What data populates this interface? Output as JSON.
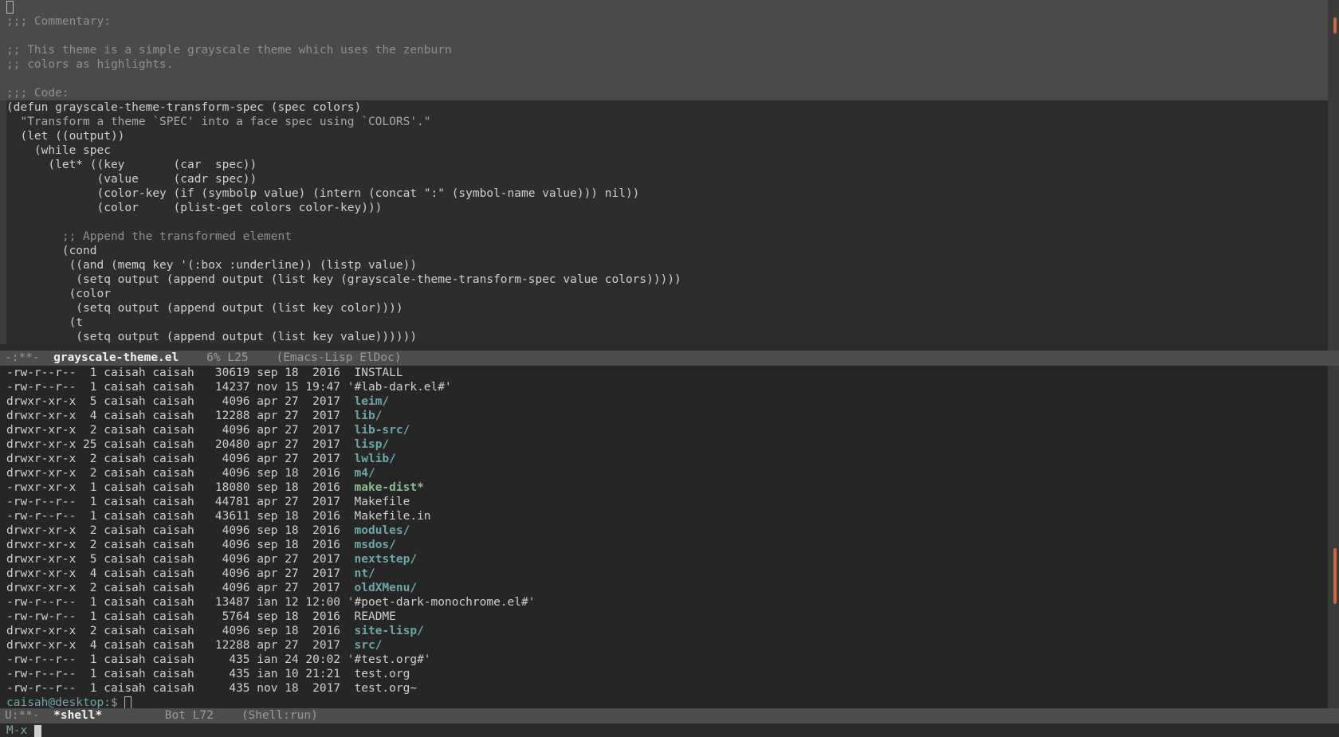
{
  "editor": {
    "commentary": [
      ";;; Commentary:",
      "",
      ";; This theme is a simple grayscale theme which uses the zenburn",
      ";; colors as highlights.",
      "",
      ";;; Code:"
    ],
    "code": [
      "(defun grayscale-theme-transform-spec (spec colors)",
      "  \"Transform a theme `SPEC' into a face spec using `COLORS'.\"",
      "  (let ((output))",
      "    (while spec",
      "      (let* ((key       (car  spec))",
      "             (value     (cadr spec))",
      "             (color-key (if (symbolp value) (intern (concat \":\" (symbol-name value))) nil))",
      "             (color     (plist-get colors color-key)))",
      "",
      "        ;; Append the transformed element",
      "        (cond",
      "         ((and (memq key '(:box :underline)) (listp value))",
      "          (setq output (append output (list key (grayscale-theme-transform-spec value colors)))))",
      "         (color",
      "          (setq output (append output (list key color))))",
      "         (t",
      "          (setq output (append output (list key value))))))"
    ]
  },
  "modeline_top": {
    "status": "-:**-  ",
    "buffer": "grayscale-theme.el",
    "position": "    6% L25    ",
    "mode": "(Emacs-Lisp ElDoc)"
  },
  "shell": {
    "rows": [
      {
        "perms": "-rw-r--r-- ",
        "links": " 1",
        "owner": "caisah",
        "group": "caisah",
        "size": "30619",
        "month": "sep",
        "day": "18",
        "time": " 2016",
        "name": "INSTALL",
        "kind": "file"
      },
      {
        "perms": "-rw-r--r-- ",
        "links": " 1",
        "owner": "caisah",
        "group": "caisah",
        "size": "14237",
        "month": "nov",
        "day": "15",
        "time": "19:47",
        "name": "'#lab-dark.el#'",
        "kind": "file",
        "quoted": true
      },
      {
        "perms": "drwxr-xr-x ",
        "links": " 5",
        "owner": "caisah",
        "group": "caisah",
        "size": " 4096",
        "month": "apr",
        "day": "27",
        "time": " 2017",
        "name": "leim",
        "kind": "dir"
      },
      {
        "perms": "drwxr-xr-x ",
        "links": " 4",
        "owner": "caisah",
        "group": "caisah",
        "size": "12288",
        "month": "apr",
        "day": "27",
        "time": " 2017",
        "name": "lib",
        "kind": "dir"
      },
      {
        "perms": "drwxr-xr-x ",
        "links": " 2",
        "owner": "caisah",
        "group": "caisah",
        "size": " 4096",
        "month": "apr",
        "day": "27",
        "time": " 2017",
        "name": "lib-src",
        "kind": "dir"
      },
      {
        "perms": "drwxr-xr-x ",
        "links": "25",
        "owner": "caisah",
        "group": "caisah",
        "size": "20480",
        "month": "apr",
        "day": "27",
        "time": " 2017",
        "name": "lisp",
        "kind": "dir"
      },
      {
        "perms": "drwxr-xr-x ",
        "links": " 2",
        "owner": "caisah",
        "group": "caisah",
        "size": " 4096",
        "month": "apr",
        "day": "27",
        "time": " 2017",
        "name": "lwlib",
        "kind": "dir"
      },
      {
        "perms": "drwxr-xr-x ",
        "links": " 2",
        "owner": "caisah",
        "group": "caisah",
        "size": " 4096",
        "month": "sep",
        "day": "18",
        "time": " 2016",
        "name": "m4",
        "kind": "dir"
      },
      {
        "perms": "-rwxr-xr-x ",
        "links": " 1",
        "owner": "caisah",
        "group": "caisah",
        "size": "18080",
        "month": "sep",
        "day": "18",
        "time": " 2016",
        "name": "make-dist",
        "kind": "exe"
      },
      {
        "perms": "-rw-r--r-- ",
        "links": " 1",
        "owner": "caisah",
        "group": "caisah",
        "size": "44781",
        "month": "apr",
        "day": "27",
        "time": " 2017",
        "name": "Makefile",
        "kind": "file"
      },
      {
        "perms": "-rw-r--r-- ",
        "links": " 1",
        "owner": "caisah",
        "group": "caisah",
        "size": "43611",
        "month": "sep",
        "day": "18",
        "time": " 2016",
        "name": "Makefile.in",
        "kind": "file"
      },
      {
        "perms": "drwxr-xr-x ",
        "links": " 2",
        "owner": "caisah",
        "group": "caisah",
        "size": " 4096",
        "month": "sep",
        "day": "18",
        "time": " 2016",
        "name": "modules",
        "kind": "dir"
      },
      {
        "perms": "drwxr-xr-x ",
        "links": " 2",
        "owner": "caisah",
        "group": "caisah",
        "size": " 4096",
        "month": "sep",
        "day": "18",
        "time": " 2016",
        "name": "msdos",
        "kind": "dir"
      },
      {
        "perms": "drwxr-xr-x ",
        "links": " 5",
        "owner": "caisah",
        "group": "caisah",
        "size": " 4096",
        "month": "apr",
        "day": "27",
        "time": " 2017",
        "name": "nextstep",
        "kind": "dir"
      },
      {
        "perms": "drwxr-xr-x ",
        "links": " 4",
        "owner": "caisah",
        "group": "caisah",
        "size": " 4096",
        "month": "apr",
        "day": "27",
        "time": " 2017",
        "name": "nt",
        "kind": "dir"
      },
      {
        "perms": "drwxr-xr-x ",
        "links": " 2",
        "owner": "caisah",
        "group": "caisah",
        "size": " 4096",
        "month": "apr",
        "day": "27",
        "time": " 2017",
        "name": "oldXMenu",
        "kind": "dir"
      },
      {
        "perms": "-rw-r--r-- ",
        "links": " 1",
        "owner": "caisah",
        "group": "caisah",
        "size": "13487",
        "month": "ian",
        "day": "12",
        "time": "12:00",
        "name": "'#poet-dark-monochrome.el#'",
        "kind": "file",
        "quoted": true
      },
      {
        "perms": "-rw-rw-r-- ",
        "links": " 1",
        "owner": "caisah",
        "group": "caisah",
        "size": " 5764",
        "month": "sep",
        "day": "18",
        "time": " 2016",
        "name": "README",
        "kind": "file"
      },
      {
        "perms": "drwxr-xr-x ",
        "links": " 2",
        "owner": "caisah",
        "group": "caisah",
        "size": " 4096",
        "month": "sep",
        "day": "18",
        "time": " 2016",
        "name": "site-lisp",
        "kind": "dir"
      },
      {
        "perms": "drwxr-xr-x ",
        "links": " 4",
        "owner": "caisah",
        "group": "caisah",
        "size": "12288",
        "month": "apr",
        "day": "27",
        "time": " 2017",
        "name": "src",
        "kind": "dir"
      },
      {
        "perms": "-rw-r--r-- ",
        "links": " 1",
        "owner": "caisah",
        "group": "caisah",
        "size": "  435",
        "month": "ian",
        "day": "24",
        "time": "20:02",
        "name": "'#test.org#'",
        "kind": "file",
        "quoted": true
      },
      {
        "perms": "-rw-r--r-- ",
        "links": " 1",
        "owner": "caisah",
        "group": "caisah",
        "size": "  435",
        "month": "ian",
        "day": "10",
        "time": "21:21",
        "name": "test.org",
        "kind": "file"
      },
      {
        "perms": "-rw-r--r-- ",
        "links": " 1",
        "owner": "caisah",
        "group": "caisah",
        "size": "  435",
        "month": "nov",
        "day": "18",
        "time": " 2017",
        "name": "test.org~",
        "kind": "file"
      }
    ],
    "prompt": "caisah@desktop:$ "
  },
  "modeline_bottom": {
    "status": "U:**-  ",
    "buffer": "*shell*",
    "position": "         Bot L72    ",
    "mode": "(Shell:run)"
  },
  "minibuffer": {
    "text": "M-x "
  },
  "colors": {
    "directory": "#6aa7a8",
    "executable": "#8bbd8d",
    "scroll_indicator": "#c76a3f",
    "modeline_bg": "#4d4d4d"
  }
}
